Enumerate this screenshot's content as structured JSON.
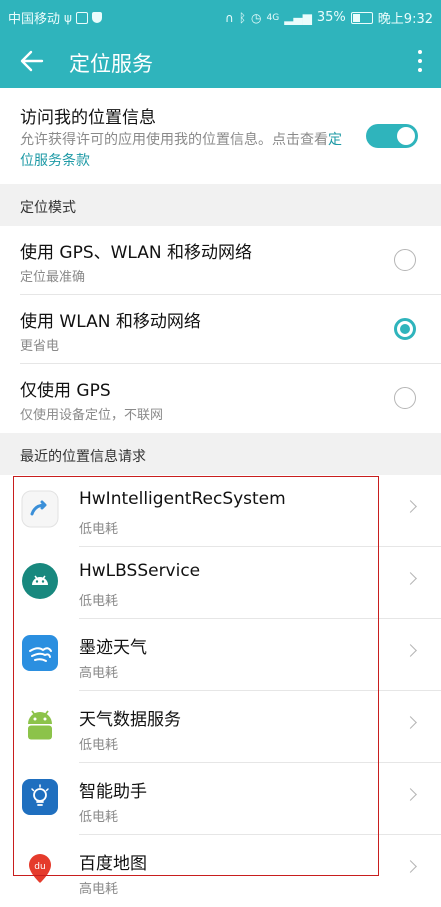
{
  "status_bar": {
    "carrier": "中国移动",
    "battery": "35%",
    "time": "晚上9:32",
    "network": "4G"
  },
  "appbar": {
    "title": "定位服务",
    "back_icon": "arrow-left-icon",
    "more_icon": "more-vert-icon"
  },
  "access": {
    "title": "访问我的位置信息",
    "desc": "允许获得许可的应用使用我的位置信息。点击查看",
    "link": "定位服务条款",
    "enabled": true
  },
  "mode_section": {
    "header": "定位模式",
    "options": [
      {
        "title": "使用 GPS、WLAN 和移动网络",
        "subtitle": "定位最准确",
        "selected": false
      },
      {
        "title": "使用 WLAN 和移动网络",
        "subtitle": "更省电",
        "selected": true
      },
      {
        "title": "仅使用 GPS",
        "subtitle": "仅使用设备定位，不联网",
        "selected": false
      }
    ]
  },
  "recent_section": {
    "header": "最近的位置信息请求",
    "apps": [
      {
        "name": "HwIntelligentRecSystem",
        "usage": "低电耗",
        "icon": "intelligent-rec-icon"
      },
      {
        "name": "HwLBSService",
        "usage": "低电耗",
        "icon": "android-lbs-icon"
      },
      {
        "name": "墨迹天气",
        "usage": "高电耗",
        "icon": "moji-weather-icon"
      },
      {
        "name": "天气数据服务",
        "usage": "低电耗",
        "icon": "android-weather-icon"
      },
      {
        "name": "智能助手",
        "usage": "低电耗",
        "icon": "smart-assistant-icon"
      },
      {
        "name": "百度地图",
        "usage": "高电耗",
        "icon": "baidu-map-icon"
      }
    ]
  },
  "colors": {
    "accent": "#2fb4bc",
    "highlight": "#c81e1e"
  }
}
